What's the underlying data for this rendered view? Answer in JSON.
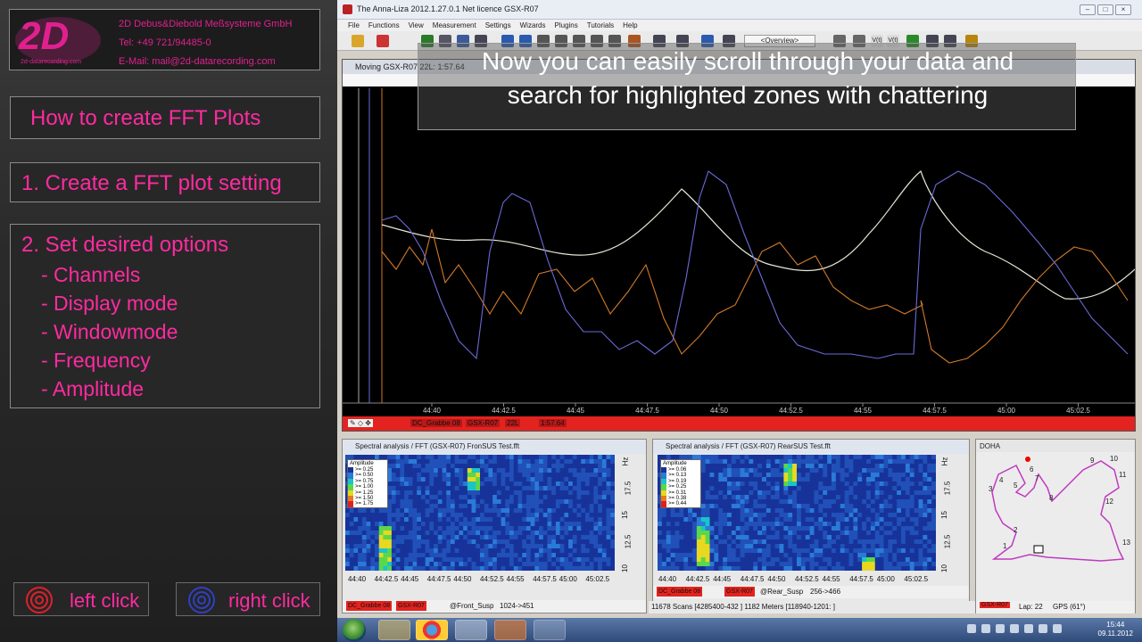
{
  "company": {
    "logo_text": "2D",
    "logo_sub": "2d-datarecording.com",
    "name": "2D Debus&Diebold Meßsysteme GmbH",
    "phone": "Tel: +49 721/94485-0",
    "email": "E-Mail: mail@2d-datarecording.com"
  },
  "tutorial": {
    "title": "How to create FFT Plots",
    "step1": "1. Create a FFT plot setting",
    "step2": "2. Set desired options",
    "options": [
      "- Channels",
      "- Display mode",
      "- Windowmode",
      "- Frequency",
      "- Amplitude"
    ]
  },
  "mouse_legend": {
    "left": "left click",
    "right": "right click"
  },
  "app": {
    "title": "The Anna-Liza 2012.1.27.0.1   Net licence   GSX-R07",
    "menu": [
      "File",
      "Functions",
      "View",
      "Measurement",
      "Settings",
      "Wizards",
      "Plugins",
      "Tutorials",
      "Help"
    ],
    "toolbar_dropdown": "<Overview>",
    "toolbar_right_labels": [
      "V(t)",
      "V(t)"
    ]
  },
  "overlay": {
    "line1": "Now you can easily scroll through your data and",
    "line2": "search for highlighted zones with chattering"
  },
  "plot": {
    "window_title": "Moving   GSX-R07 22L: 1:57.64",
    "x_ticks": [
      "44:40",
      "44:42.5",
      "44:45",
      "44:47.5",
      "44:50",
      "44:52.5",
      "44:55",
      "44:57.5",
      "45:00",
      "45:02.5"
    ],
    "bottom_labels": [
      "DC_Grabbe 08",
      "GSX-R07",
      "22L",
      "1:57.64"
    ],
    "colors": {
      "white": "#e6e6d6",
      "orange": "#d07a2a",
      "blue": "#6a6ad8"
    }
  },
  "fft_front": {
    "title": "Spectral analysis / FFT (GSX-R07)   FronSUS Test.fft",
    "legend_title": "Amplitude",
    "legend_values": [
      ">= 0.25",
      ">= 0.50",
      ">= 0.75",
      ">= 1.00",
      ">= 1.25",
      ">= 1.50",
      ">= 1.75"
    ],
    "x_ticks": [
      "44:40",
      "44:42.5",
      "44:45",
      "44:47.5",
      "44:50",
      "44:52.5",
      "44:55",
      "44:57.5",
      "45:00",
      "45:02.5"
    ],
    "y_ticks": [
      "10",
      "12.5",
      "15",
      "17.5",
      "Hz"
    ],
    "bar": [
      "DC_Grabbe 08",
      "GSX-R07",
      "@Front_Susp",
      "1024->451"
    ]
  },
  "fft_rear": {
    "title": "Spectral analysis / FFT (GSX-R07)   RearSUS Test.fft",
    "legend_title": "Amplitude",
    "legend_values": [
      ">= 0.06",
      ">= 0.13",
      ">= 0.19",
      ">= 0.25",
      ">= 0.31",
      ">= 0.38",
      ">= 0.44"
    ],
    "x_ticks": [
      "44:40",
      "44:42.5",
      "44:45",
      "44:47.5",
      "44:50",
      "44:52.5",
      "44:55",
      "44:57.5",
      "45:00",
      "45:02.5"
    ],
    "y_ticks": [
      "10",
      "12.5",
      "15",
      "17.5",
      "Hz"
    ],
    "bar": [
      "DC_Grabbe 08",
      "GSX-R07",
      "@Rear_Susp",
      "256->466"
    ]
  },
  "map": {
    "title": "DOHA",
    "corners": [
      "1",
      "2",
      "3",
      "4",
      "5",
      "6",
      "7",
      "8",
      "9",
      "10",
      "11",
      "12",
      "13"
    ],
    "lap": "Lap: 22",
    "gps": "GPS (61°)",
    "chip": "GSX-R07"
  },
  "statusbar": "11678 Scans [4285400-432 ] 1182 Meters [118940-1201: ]",
  "taskbar": {
    "time": "15:44",
    "date": "09.11.2012"
  }
}
